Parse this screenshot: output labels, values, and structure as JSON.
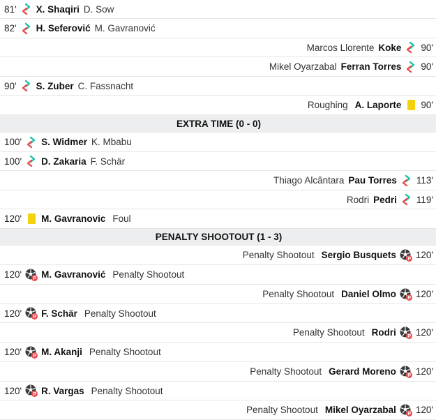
{
  "colors": {
    "sub_in": "#1bbfa4",
    "sub_out": "#e8494b",
    "yellow_card": "#f5d10c",
    "header_bg": "#eceef0",
    "penalty_badge": "#e8494b"
  },
  "events": [
    {
      "kind": "sub",
      "side": "left",
      "minute": "81'",
      "player": "X. Shaqiri",
      "detail": "D. Sow",
      "icon": "substitution-icon"
    },
    {
      "kind": "sub",
      "side": "left",
      "minute": "82'",
      "player": "H. Seferović",
      "detail": "M. Gavranović",
      "icon": "substitution-icon"
    },
    {
      "kind": "sub",
      "side": "right",
      "minute": "90'",
      "player": "Koke",
      "detail": "Marcos Llorente",
      "icon": "substitution-icon"
    },
    {
      "kind": "sub",
      "side": "right",
      "minute": "90'",
      "player": "Ferran Torres",
      "detail": "Mikel Oyarzabal",
      "icon": "substitution-icon"
    },
    {
      "kind": "sub",
      "side": "left",
      "minute": "90'",
      "player": "S. Zuber",
      "detail": "C. Fassnacht",
      "icon": "substitution-icon"
    },
    {
      "kind": "card",
      "side": "right",
      "minute": "90'",
      "player": "A. Laporte",
      "detail": "Roughing",
      "icon": "yellow-card-icon"
    },
    {
      "kind": "header",
      "label": "EXTRA TIME (0 - 0)"
    },
    {
      "kind": "sub",
      "side": "left",
      "minute": "100'",
      "player": "S. Widmer",
      "detail": "K. Mbabu",
      "icon": "substitution-icon"
    },
    {
      "kind": "sub",
      "side": "left",
      "minute": "100'",
      "player": "D. Zakaria",
      "detail": "F. Schär",
      "icon": "substitution-icon"
    },
    {
      "kind": "sub",
      "side": "right",
      "minute": "113'",
      "player": "Pau Torres",
      "detail": "Thiago Alcântara",
      "icon": "substitution-icon"
    },
    {
      "kind": "sub",
      "side": "right",
      "minute": "119'",
      "player": "Pedri",
      "detail": "Rodri",
      "icon": "substitution-icon"
    },
    {
      "kind": "card",
      "side": "left",
      "minute": "120'",
      "player": "M. Gavranovic",
      "detail": "Foul",
      "icon": "yellow-card-icon"
    },
    {
      "kind": "header",
      "label": "PENALTY SHOOTOUT (1 - 3)"
    },
    {
      "kind": "pen",
      "side": "right",
      "minute": "120'",
      "player": "Sergio Busquets",
      "detail": "Penalty Shootout",
      "icon": "penalty-ball-icon"
    },
    {
      "kind": "pen",
      "side": "left",
      "minute": "120'",
      "player": "M. Gavranović",
      "detail": "Penalty Shootout",
      "icon": "penalty-ball-icon"
    },
    {
      "kind": "pen",
      "side": "right",
      "minute": "120'",
      "player": "Daniel Olmo",
      "detail": "Penalty Shootout",
      "icon": "penalty-ball-icon"
    },
    {
      "kind": "pen",
      "side": "left",
      "minute": "120'",
      "player": "F. Schär",
      "detail": "Penalty Shootout",
      "icon": "penalty-ball-icon"
    },
    {
      "kind": "pen",
      "side": "right",
      "minute": "120'",
      "player": "Rodri",
      "detail": "Penalty Shootout",
      "icon": "penalty-ball-icon"
    },
    {
      "kind": "pen",
      "side": "left",
      "minute": "120'",
      "player": "M. Akanji",
      "detail": "Penalty Shootout",
      "icon": "penalty-ball-icon"
    },
    {
      "kind": "pen",
      "side": "right",
      "minute": "120'",
      "player": "Gerard Moreno",
      "detail": "Penalty Shootout",
      "icon": "penalty-ball-icon"
    },
    {
      "kind": "pen",
      "side": "left",
      "minute": "120'",
      "player": "R. Vargas",
      "detail": "Penalty Shootout",
      "icon": "penalty-ball-icon"
    },
    {
      "kind": "pen",
      "side": "right",
      "minute": "120'",
      "player": "Mikel Oyarzabal",
      "detail": "Penalty Shootout",
      "icon": "penalty-ball-icon"
    }
  ]
}
